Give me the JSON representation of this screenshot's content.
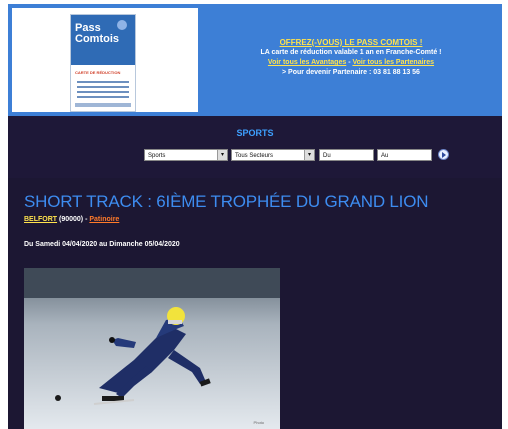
{
  "header": {
    "card": {
      "logo_line1": "Pass",
      "logo_line2": "Comtois",
      "subtitle": "CARTE DE RÉDUCTION"
    },
    "promo": {
      "title": "OFFREZ(-VOUS) LE PASS COMTOIS !",
      "line1": "LA carte de réduction valable 1 an en Franche-Comté !",
      "link_advantages": "Voir tous les Avantages",
      "separator": " - ",
      "link_partners": "Voir tous les Partenaires",
      "partner_line": "> Pour devenir Partenaire : 03 81 88 13 56"
    },
    "colors": {
      "header_bg": "#3d7fd6",
      "promo_title": "#ffe34d"
    }
  },
  "nav": {
    "section_label": "SPORTS",
    "category_select": "Sports",
    "sector_select": "Tous Secteurs",
    "date_from_placeholder": "Du",
    "date_to_placeholder": "Au",
    "go_icon": "go-arrow-icon"
  },
  "event": {
    "title": "SHORT TRACK : 6IÈME TROPHÉE DU GRAND LION",
    "city": "BELFORT",
    "postcode": " (90000) - ",
    "category_link": "Patinoire",
    "dates": "Du Samedi 04/04/2020 au Dimanche 05/04/2020",
    "photo_alt_icon": "short-track-skater-photo",
    "photo_credit": "Photo"
  }
}
